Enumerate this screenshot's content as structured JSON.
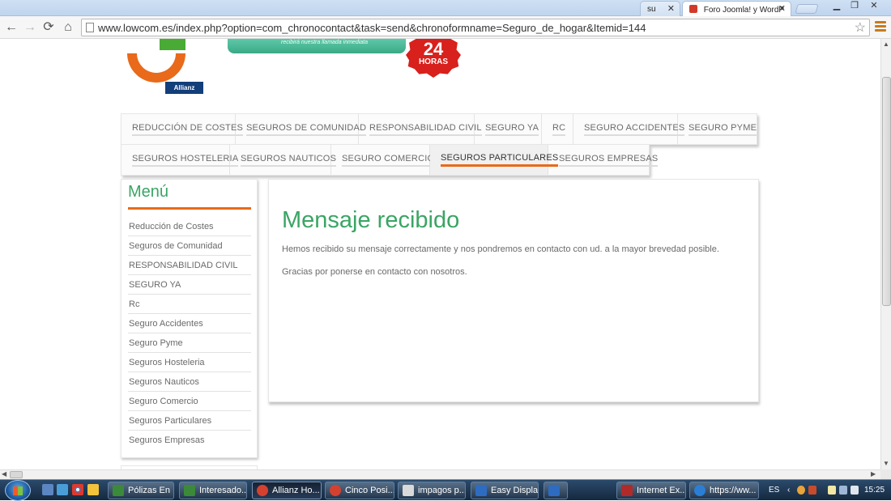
{
  "browser": {
    "tabs": [
      {
        "title": "su",
        "active": false
      },
      {
        "title": "Foro Joomla! y WordP",
        "active": true
      }
    ],
    "url": "www.lowcom.es/index.php?option=com_chronocontact&task=send&chronoformname=Seguro_de_hogar&Itemid=144"
  },
  "header": {
    "logo_brand": "Allianz",
    "banner_text": "recibirá nuestra llamada inmediata",
    "badge_number": "24",
    "badge_text": "HORAS"
  },
  "top_menu": {
    "row1": [
      "REDUCCIÓN DE COSTES",
      "SEGUROS DE COMUNIDAD",
      "RESPONSABILIDAD CIVIL",
      "SEGURO YA",
      "RC",
      "SEGURO ACCIDENTES",
      "SEGURO PYME"
    ],
    "row2": [
      "SEGUROS HOSTELERIA",
      "SEGUROS NAUTICOS",
      "SEGURO COMERCIO",
      "SEGUROS PARTICULARES",
      "SEGUROS EMPRESAS"
    ],
    "active": "SEGUROS PARTICULARES"
  },
  "sidebar": {
    "title": "Menú",
    "items": [
      "Reducción de Costes",
      "Seguros de Comunidad",
      "RESPONSABILIDAD CIVIL",
      "SEGURO YA",
      "Rc",
      "Seguro Accidentes",
      "Seguro Pyme",
      "Seguros Hosteleria",
      "Seguros Nauticos",
      "Seguro Comercio",
      "Seguros Particulares",
      "Seguros Empresas"
    ]
  },
  "main": {
    "title": "Mensaje recibido",
    "paragraph1": "Hemos recibido su mensaje correctamente y nos pondremos en contacto con ud. a la mayor brevedad posible.",
    "paragraph2": "Gracias por ponerse en contacto con nosotros."
  },
  "taskbar": {
    "tasks": [
      {
        "label": "Pólizas En ...",
        "color": "#3b8a3a"
      },
      {
        "label": "Interesado...",
        "color": "#3b8a3a"
      },
      {
        "label": "Allianz Ho...",
        "color": "#d5412f",
        "active": true
      },
      {
        "label": "Cinco Posi...",
        "color": "#d5412f"
      },
      {
        "label": "impagos p...",
        "color": "#d9d9d9"
      },
      {
        "label": "Easy Displa...",
        "color": "#2d6cc0"
      },
      {
        "label": "",
        "color": "#2d6cc0"
      },
      {
        "label": "Internet Ex...",
        "color": "#b12a2a"
      },
      {
        "label": "https://ww...",
        "color": "#2a7fd4"
      }
    ],
    "language": "ES",
    "clock": "15:25"
  }
}
